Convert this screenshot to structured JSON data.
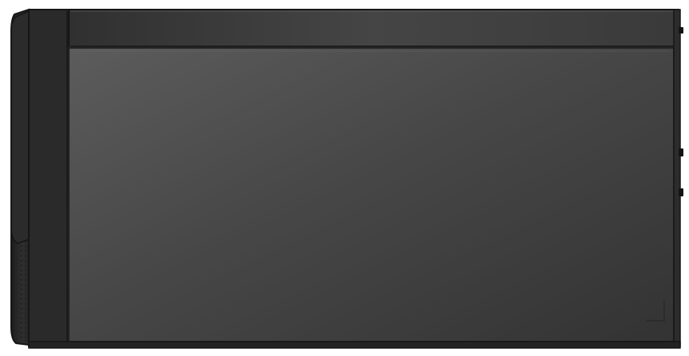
{
  "scene": {
    "subject": "tower-pc-side-view",
    "colors": {
      "background": "#ffffff",
      "panel_light": "#5c5c5c",
      "panel_mid": "#474747",
      "panel_dark": "#333333",
      "top_strip": "#454545",
      "top_strip_dark": "#303030",
      "front_bezel": "#2f2f2f",
      "front_bezel_edge": "#1c1c1c",
      "outline": "#161616",
      "panel_edge": "#242424",
      "port": "#141414",
      "vent": "#262626",
      "highlight": "#6e6e6e"
    }
  }
}
